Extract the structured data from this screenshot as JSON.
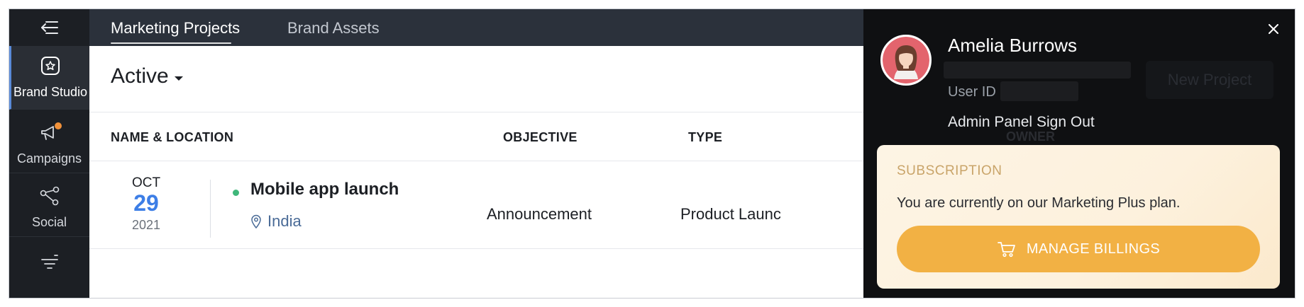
{
  "sidebar": {
    "toggle_icon": "collapse-menu-icon",
    "items": [
      {
        "label": "Brand Studio",
        "icon": "brand-studio-icon",
        "active": true
      },
      {
        "label": "Campaigns",
        "icon": "megaphone-icon",
        "badge_color": "#f0913a"
      },
      {
        "label": "Social",
        "icon": "social-share-icon"
      },
      {
        "label": "",
        "icon": "filter-lines-icon"
      }
    ]
  },
  "topbar": {
    "tabs": [
      {
        "label": "Marketing Projects",
        "active": true
      },
      {
        "label": "Brand Assets",
        "active": false
      }
    ]
  },
  "main": {
    "status_filter": "Active",
    "columns": [
      "NAME & LOCATION",
      "OBJECTIVE",
      "TYPE",
      "OWNER"
    ],
    "rows": [
      {
        "month": "OCT",
        "day": "29",
        "year": "2021",
        "name": "Mobile app launch",
        "location": "India",
        "objective": "Announcement",
        "type": "Product Launc"
      }
    ],
    "new_project_label": "New Project"
  },
  "user_panel": {
    "name": "Amelia Burrows",
    "user_id_label": "User ID :",
    "links": [
      "Admin Panel",
      "Sign Out"
    ],
    "subscription": {
      "title": "SUBSCRIPTION",
      "text": "You are currently on our Marketing Plus plan.",
      "button_label": "MANAGE BILLINGS",
      "button_icon": "cart-icon"
    }
  },
  "colors": {
    "accent_blue": "#3d7ee6",
    "billing_orange": "#f2b144",
    "status_green": "#3fb77a",
    "sidebar_bg": "#1c1f24",
    "topbar_bg": "#2b313b"
  }
}
